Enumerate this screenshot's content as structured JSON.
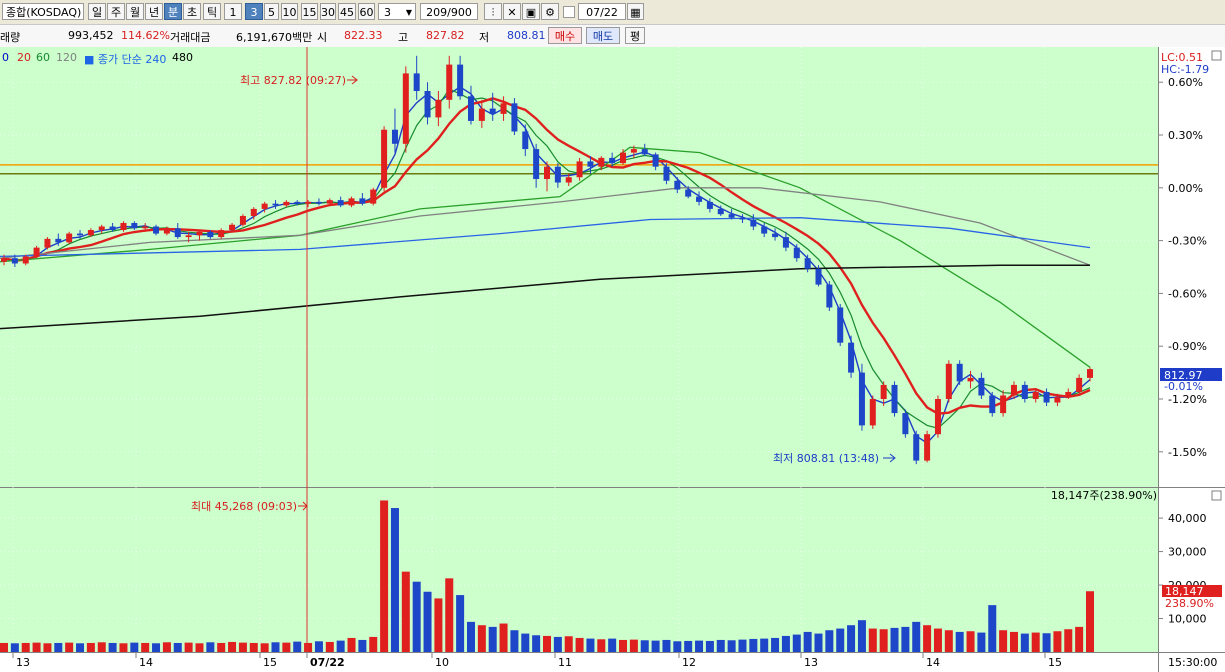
{
  "toolbar": {
    "symbol": "종합(KOSDAQ)",
    "periods": [
      "일",
      "주",
      "월",
      "년",
      "분",
      "초",
      "틱"
    ],
    "active_period": "분",
    "intervals": [
      "1",
      "3",
      "5",
      "10",
      "15",
      "30",
      "45",
      "60"
    ],
    "active_interval": "3",
    "interval_select": "3",
    "count": "209/900",
    "date": "07/22",
    "icons": [
      "candle-tool-icon",
      "cross-tool-icon",
      "save-icon",
      "settings-icon",
      "checkbox-icon",
      "calendar-icon"
    ]
  },
  "info_bar": {
    "volume_label": "래량",
    "volume": "993,452",
    "volume_pct": "114.62%",
    "amount_label": "거래대금",
    "amount": "6,191,670백만",
    "open_label": "시",
    "open": "822.33",
    "high_label": "고",
    "high": "827.82",
    "low_label": "저",
    "low": "808.81",
    "buy_button": "매수",
    "sell_button": "매도",
    "eval_button": "평"
  },
  "legend": {
    "ma_items": [
      {
        "label": "0",
        "color": "#0000cc"
      },
      {
        "label": "20",
        "color": "#d81e1e"
      },
      {
        "label": "60",
        "color": "#178a2e"
      },
      {
        "label": "120",
        "color": "#808080"
      },
      {
        "label": "■ 종가 단순 240",
        "color": "#1e64e6"
      },
      {
        "label": "480",
        "color": "#000000"
      }
    ],
    "lc": "LC:0.51",
    "hc": "HC:-1.79"
  },
  "price_axis": {
    "ticks": [
      "0.60%",
      "0.30%",
      "0.00%",
      "-0.30%",
      "-0.60%",
      "-0.90%",
      "-1.20%",
      "-1.50%"
    ],
    "last_price": "812.97",
    "last_pct": "-0.01%",
    "level_lines": [
      {
        "pct": 0.13,
        "color": "#f0a000"
      },
      {
        "pct": 0.08,
        "color": "#6b7a10"
      }
    ]
  },
  "annotations": {
    "high": "최고 827.82 (09:27)",
    "low": "최저 808.81 (13:48)",
    "vol_max": "최대 45,268 (09:03)"
  },
  "volume_panel": {
    "header": "18,147주(238.90%)",
    "ticks": [
      "40,000",
      "30,000",
      "20,000",
      "10,000"
    ],
    "last_volume": "18,147",
    "last_pct": "238.90%"
  },
  "time_axis": {
    "labels": [
      "13",
      "14",
      "15",
      "07/22",
      "10",
      "11",
      "12",
      "13",
      "14",
      "15"
    ],
    "clock": "15:30:00"
  },
  "chart_data": {
    "type": "candlestick",
    "interval": "3분",
    "series_ohlc_pct": [
      [
        -0.42,
        -0.38,
        -0.44,
        -0.4
      ],
      [
        -0.4,
        -0.38,
        -0.45,
        -0.43
      ],
      [
        -0.43,
        -0.38,
        -0.44,
        -0.39
      ],
      [
        -0.39,
        -0.33,
        -0.4,
        -0.34
      ],
      [
        -0.34,
        -0.28,
        -0.35,
        -0.29
      ],
      [
        -0.29,
        -0.26,
        -0.33,
        -0.31
      ],
      [
        -0.31,
        -0.25,
        -0.32,
        -0.26
      ],
      [
        -0.26,
        -0.24,
        -0.29,
        -0.27
      ],
      [
        -0.27,
        -0.23,
        -0.28,
        -0.24
      ],
      [
        -0.24,
        -0.21,
        -0.26,
        -0.22
      ],
      [
        -0.22,
        -0.2,
        -0.25,
        -0.24
      ],
      [
        -0.24,
        -0.19,
        -0.25,
        -0.2
      ],
      [
        -0.2,
        -0.19,
        -0.24,
        -0.23
      ],
      [
        -0.23,
        -0.2,
        -0.25,
        -0.22
      ],
      [
        -0.22,
        -0.21,
        -0.27,
        -0.26
      ],
      [
        -0.26,
        -0.22,
        -0.27,
        -0.23
      ],
      [
        -0.23,
        -0.2,
        -0.29,
        -0.28
      ],
      [
        -0.28,
        -0.25,
        -0.31,
        -0.27
      ],
      [
        -0.27,
        -0.24,
        -0.3,
        -0.25
      ],
      [
        -0.25,
        -0.24,
        -0.29,
        -0.28
      ],
      [
        -0.28,
        -0.23,
        -0.29,
        -0.24
      ],
      [
        -0.24,
        -0.2,
        -0.25,
        -0.21
      ],
      [
        -0.21,
        -0.15,
        -0.22,
        -0.16
      ],
      [
        -0.16,
        -0.11,
        -0.18,
        -0.12
      ],
      [
        -0.12,
        -0.08,
        -0.14,
        -0.09
      ],
      [
        -0.09,
        -0.07,
        -0.12,
        -0.1
      ],
      [
        -0.1,
        -0.07,
        -0.11,
        -0.08
      ],
      [
        -0.08,
        -0.07,
        -0.1,
        -0.09
      ],
      [
        -0.09,
        -0.07,
        -0.11,
        -0.08
      ],
      [
        -0.08,
        -0.06,
        -0.1,
        -0.09
      ],
      [
        -0.09,
        -0.06,
        -0.1,
        -0.07
      ],
      [
        -0.07,
        -0.05,
        -0.11,
        -0.1
      ],
      [
        -0.1,
        -0.05,
        -0.11,
        -0.06
      ],
      [
        -0.06,
        -0.03,
        -0.1,
        -0.09
      ],
      [
        -0.09,
        0.0,
        -0.1,
        -0.01
      ],
      [
        0.0,
        0.35,
        -0.02,
        0.33
      ],
      [
        0.33,
        0.45,
        0.2,
        0.25
      ],
      [
        0.25,
        0.69,
        0.2,
        0.65
      ],
      [
        0.65,
        0.75,
        0.5,
        0.55
      ],
      [
        0.55,
        0.6,
        0.36,
        0.4
      ],
      [
        0.4,
        0.55,
        0.35,
        0.5
      ],
      [
        0.5,
        0.75,
        0.45,
        0.7
      ],
      [
        0.7,
        0.75,
        0.5,
        0.52
      ],
      [
        0.52,
        0.58,
        0.36,
        0.38
      ],
      [
        0.38,
        0.5,
        0.34,
        0.45
      ],
      [
        0.45,
        0.54,
        0.38,
        0.42
      ],
      [
        0.42,
        0.52,
        0.38,
        0.48
      ],
      [
        0.48,
        0.51,
        0.3,
        0.32
      ],
      [
        0.32,
        0.36,
        0.18,
        0.22
      ],
      [
        0.22,
        0.25,
        0.0,
        0.05
      ],
      [
        0.05,
        0.15,
        -0.02,
        0.12
      ],
      [
        0.12,
        0.14,
        0.0,
        0.03
      ],
      [
        0.03,
        0.08,
        0.01,
        0.06
      ],
      [
        0.06,
        0.17,
        0.04,
        0.15
      ],
      [
        0.15,
        0.18,
        0.08,
        0.12
      ],
      [
        0.12,
        0.18,
        0.1,
        0.17
      ],
      [
        0.17,
        0.2,
        0.12,
        0.14
      ],
      [
        0.14,
        0.22,
        0.13,
        0.2
      ],
      [
        0.2,
        0.24,
        0.17,
        0.22
      ],
      [
        0.22,
        0.25,
        0.18,
        0.19
      ],
      [
        0.19,
        0.2,
        0.1,
        0.12
      ],
      [
        0.12,
        0.14,
        0.02,
        0.04
      ],
      [
        0.04,
        0.06,
        -0.03,
        -0.01
      ],
      [
        -0.01,
        0.01,
        -0.06,
        -0.05
      ],
      [
        -0.05,
        -0.02,
        -0.1,
        -0.08
      ],
      [
        -0.08,
        -0.06,
        -0.14,
        -0.12
      ],
      [
        -0.12,
        -0.1,
        -0.16,
        -0.15
      ],
      [
        -0.15,
        -0.12,
        -0.18,
        -0.17
      ],
      [
        -0.17,
        -0.15,
        -0.2,
        -0.18
      ],
      [
        -0.18,
        -0.15,
        -0.24,
        -0.22
      ],
      [
        -0.22,
        -0.2,
        -0.28,
        -0.26
      ],
      [
        -0.26,
        -0.23,
        -0.3,
        -0.28
      ],
      [
        -0.28,
        -0.25,
        -0.36,
        -0.34
      ],
      [
        -0.34,
        -0.32,
        -0.42,
        -0.4
      ],
      [
        -0.4,
        -0.38,
        -0.48,
        -0.46
      ],
      [
        -0.46,
        -0.44,
        -0.56,
        -0.55
      ],
      [
        -0.55,
        -0.53,
        -0.7,
        -0.68
      ],
      [
        -0.68,
        -0.66,
        -0.9,
        -0.88
      ],
      [
        -0.88,
        -0.84,
        -1.08,
        -1.05
      ],
      [
        -1.05,
        -1.0,
        -1.38,
        -1.35
      ],
      [
        -1.35,
        -1.18,
        -1.37,
        -1.2
      ],
      [
        -1.2,
        -1.1,
        -1.24,
        -1.12
      ],
      [
        -1.12,
        -1.1,
        -1.3,
        -1.28
      ],
      [
        -1.28,
        -1.26,
        -1.42,
        -1.4
      ],
      [
        -1.4,
        -1.38,
        -1.57,
        -1.55
      ],
      [
        -1.55,
        -1.38,
        -1.56,
        -1.4
      ],
      [
        -1.4,
        -1.18,
        -1.42,
        -1.2
      ],
      [
        -1.2,
        -0.98,
        -1.22,
        -1.0
      ],
      [
        -1.0,
        -0.98,
        -1.12,
        -1.1
      ],
      [
        -1.1,
        -1.04,
        -1.14,
        -1.08
      ],
      [
        -1.08,
        -1.05,
        -1.2,
        -1.18
      ],
      [
        -1.18,
        -1.16,
        -1.3,
        -1.28
      ],
      [
        -1.28,
        -1.15,
        -1.3,
        -1.18
      ],
      [
        -1.18,
        -1.1,
        -1.2,
        -1.12
      ],
      [
        -1.12,
        -1.1,
        -1.22,
        -1.2
      ],
      [
        -1.2,
        -1.14,
        -1.22,
        -1.16
      ],
      [
        -1.16,
        -1.14,
        -1.24,
        -1.22
      ],
      [
        -1.22,
        -1.17,
        -1.24,
        -1.19
      ],
      [
        -1.19,
        -1.14,
        -1.2,
        -1.16
      ],
      [
        -1.16,
        -1.06,
        -1.17,
        -1.08
      ],
      [
        -1.08,
        -1.02,
        -1.1,
        -1.03
      ]
    ],
    "volume": [
      2700,
      2600,
      2700,
      2800,
      2600,
      2700,
      2800,
      2600,
      2700,
      2900,
      2700,
      2600,
      2800,
      2700,
      2600,
      2900,
      2700,
      2800,
      2600,
      2900,
      2700,
      3000,
      2800,
      2700,
      2600,
      2900,
      2800,
      3100,
      2700,
      3200,
      3000,
      3400,
      4200,
      3600,
      4500,
      45268,
      43000,
      24000,
      21000,
      18000,
      16000,
      22000,
      17000,
      9000,
      8000,
      7500,
      8500,
      6500,
      5500,
      5000,
      4800,
      4500,
      4700,
      4200,
      4000,
      3800,
      4000,
      3600,
      3700,
      3500,
      3400,
      3600,
      3200,
      3300,
      3400,
      3300,
      3600,
      3500,
      3700,
      3900,
      4000,
      4200,
      4800,
      5200,
      6000,
      5500,
      6500,
      7000,
      8000,
      9500,
      7000,
      6800,
      7200,
      7500,
      9000,
      8000,
      7000,
      6500,
      6000,
      6200,
      5800,
      14000,
      6500,
      6000,
      5500,
      5800,
      5600,
      6200,
      6800,
      7500,
      18147
    ],
    "xlabel": "",
    "ylabel": "",
    "ylim": [
      -1.7,
      0.8
    ],
    "volume_ylim": [
      0,
      46000
    ],
    "colors": {
      "up": "#e0201e",
      "down": "#1e46c8",
      "ma5": "#1e3cc8",
      "ma10": "#178a2e",
      "ma20": "#e0201e",
      "ma60": "#2aa02a",
      "ma120": "#808080",
      "ma240": "#2a64e6",
      "ma480": "#101010"
    }
  }
}
